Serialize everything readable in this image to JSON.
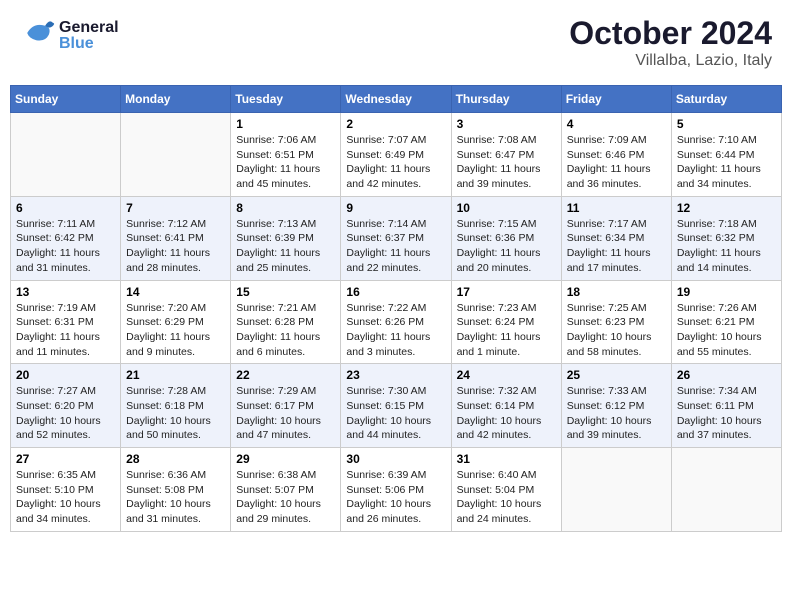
{
  "header": {
    "title": "October 2024",
    "subtitle": "Villalba, Lazio, Italy",
    "logo_general": "General",
    "logo_blue": "Blue"
  },
  "days_of_week": [
    "Sunday",
    "Monday",
    "Tuesday",
    "Wednesday",
    "Thursday",
    "Friday",
    "Saturday"
  ],
  "weeks": [
    [
      {
        "day": "",
        "info": ""
      },
      {
        "day": "",
        "info": ""
      },
      {
        "day": "1",
        "sunrise": "Sunrise: 7:06 AM",
        "sunset": "Sunset: 6:51 PM",
        "daylight": "Daylight: 11 hours and 45 minutes."
      },
      {
        "day": "2",
        "sunrise": "Sunrise: 7:07 AM",
        "sunset": "Sunset: 6:49 PM",
        "daylight": "Daylight: 11 hours and 42 minutes."
      },
      {
        "day": "3",
        "sunrise": "Sunrise: 7:08 AM",
        "sunset": "Sunset: 6:47 PM",
        "daylight": "Daylight: 11 hours and 39 minutes."
      },
      {
        "day": "4",
        "sunrise": "Sunrise: 7:09 AM",
        "sunset": "Sunset: 6:46 PM",
        "daylight": "Daylight: 11 hours and 36 minutes."
      },
      {
        "day": "5",
        "sunrise": "Sunrise: 7:10 AM",
        "sunset": "Sunset: 6:44 PM",
        "daylight": "Daylight: 11 hours and 34 minutes."
      }
    ],
    [
      {
        "day": "6",
        "sunrise": "Sunrise: 7:11 AM",
        "sunset": "Sunset: 6:42 PM",
        "daylight": "Daylight: 11 hours and 31 minutes."
      },
      {
        "day": "7",
        "sunrise": "Sunrise: 7:12 AM",
        "sunset": "Sunset: 6:41 PM",
        "daylight": "Daylight: 11 hours and 28 minutes."
      },
      {
        "day": "8",
        "sunrise": "Sunrise: 7:13 AM",
        "sunset": "Sunset: 6:39 PM",
        "daylight": "Daylight: 11 hours and 25 minutes."
      },
      {
        "day": "9",
        "sunrise": "Sunrise: 7:14 AM",
        "sunset": "Sunset: 6:37 PM",
        "daylight": "Daylight: 11 hours and 22 minutes."
      },
      {
        "day": "10",
        "sunrise": "Sunrise: 7:15 AM",
        "sunset": "Sunset: 6:36 PM",
        "daylight": "Daylight: 11 hours and 20 minutes."
      },
      {
        "day": "11",
        "sunrise": "Sunrise: 7:17 AM",
        "sunset": "Sunset: 6:34 PM",
        "daylight": "Daylight: 11 hours and 17 minutes."
      },
      {
        "day": "12",
        "sunrise": "Sunrise: 7:18 AM",
        "sunset": "Sunset: 6:32 PM",
        "daylight": "Daylight: 11 hours and 14 minutes."
      }
    ],
    [
      {
        "day": "13",
        "sunrise": "Sunrise: 7:19 AM",
        "sunset": "Sunset: 6:31 PM",
        "daylight": "Daylight: 11 hours and 11 minutes."
      },
      {
        "day": "14",
        "sunrise": "Sunrise: 7:20 AM",
        "sunset": "Sunset: 6:29 PM",
        "daylight": "Daylight: 11 hours and 9 minutes."
      },
      {
        "day": "15",
        "sunrise": "Sunrise: 7:21 AM",
        "sunset": "Sunset: 6:28 PM",
        "daylight": "Daylight: 11 hours and 6 minutes."
      },
      {
        "day": "16",
        "sunrise": "Sunrise: 7:22 AM",
        "sunset": "Sunset: 6:26 PM",
        "daylight": "Daylight: 11 hours and 3 minutes."
      },
      {
        "day": "17",
        "sunrise": "Sunrise: 7:23 AM",
        "sunset": "Sunset: 6:24 PM",
        "daylight": "Daylight: 11 hours and 1 minute."
      },
      {
        "day": "18",
        "sunrise": "Sunrise: 7:25 AM",
        "sunset": "Sunset: 6:23 PM",
        "daylight": "Daylight: 10 hours and 58 minutes."
      },
      {
        "day": "19",
        "sunrise": "Sunrise: 7:26 AM",
        "sunset": "Sunset: 6:21 PM",
        "daylight": "Daylight: 10 hours and 55 minutes."
      }
    ],
    [
      {
        "day": "20",
        "sunrise": "Sunrise: 7:27 AM",
        "sunset": "Sunset: 6:20 PM",
        "daylight": "Daylight: 10 hours and 52 minutes."
      },
      {
        "day": "21",
        "sunrise": "Sunrise: 7:28 AM",
        "sunset": "Sunset: 6:18 PM",
        "daylight": "Daylight: 10 hours and 50 minutes."
      },
      {
        "day": "22",
        "sunrise": "Sunrise: 7:29 AM",
        "sunset": "Sunset: 6:17 PM",
        "daylight": "Daylight: 10 hours and 47 minutes."
      },
      {
        "day": "23",
        "sunrise": "Sunrise: 7:30 AM",
        "sunset": "Sunset: 6:15 PM",
        "daylight": "Daylight: 10 hours and 44 minutes."
      },
      {
        "day": "24",
        "sunrise": "Sunrise: 7:32 AM",
        "sunset": "Sunset: 6:14 PM",
        "daylight": "Daylight: 10 hours and 42 minutes."
      },
      {
        "day": "25",
        "sunrise": "Sunrise: 7:33 AM",
        "sunset": "Sunset: 6:12 PM",
        "daylight": "Daylight: 10 hours and 39 minutes."
      },
      {
        "day": "26",
        "sunrise": "Sunrise: 7:34 AM",
        "sunset": "Sunset: 6:11 PM",
        "daylight": "Daylight: 10 hours and 37 minutes."
      }
    ],
    [
      {
        "day": "27",
        "sunrise": "Sunrise: 6:35 AM",
        "sunset": "Sunset: 5:10 PM",
        "daylight": "Daylight: 10 hours and 34 minutes."
      },
      {
        "day": "28",
        "sunrise": "Sunrise: 6:36 AM",
        "sunset": "Sunset: 5:08 PM",
        "daylight": "Daylight: 10 hours and 31 minutes."
      },
      {
        "day": "29",
        "sunrise": "Sunrise: 6:38 AM",
        "sunset": "Sunset: 5:07 PM",
        "daylight": "Daylight: 10 hours and 29 minutes."
      },
      {
        "day": "30",
        "sunrise": "Sunrise: 6:39 AM",
        "sunset": "Sunset: 5:06 PM",
        "daylight": "Daylight: 10 hours and 26 minutes."
      },
      {
        "day": "31",
        "sunrise": "Sunrise: 6:40 AM",
        "sunset": "Sunset: 5:04 PM",
        "daylight": "Daylight: 10 hours and 24 minutes."
      },
      {
        "day": "",
        "info": ""
      },
      {
        "day": "",
        "info": ""
      }
    ]
  ]
}
